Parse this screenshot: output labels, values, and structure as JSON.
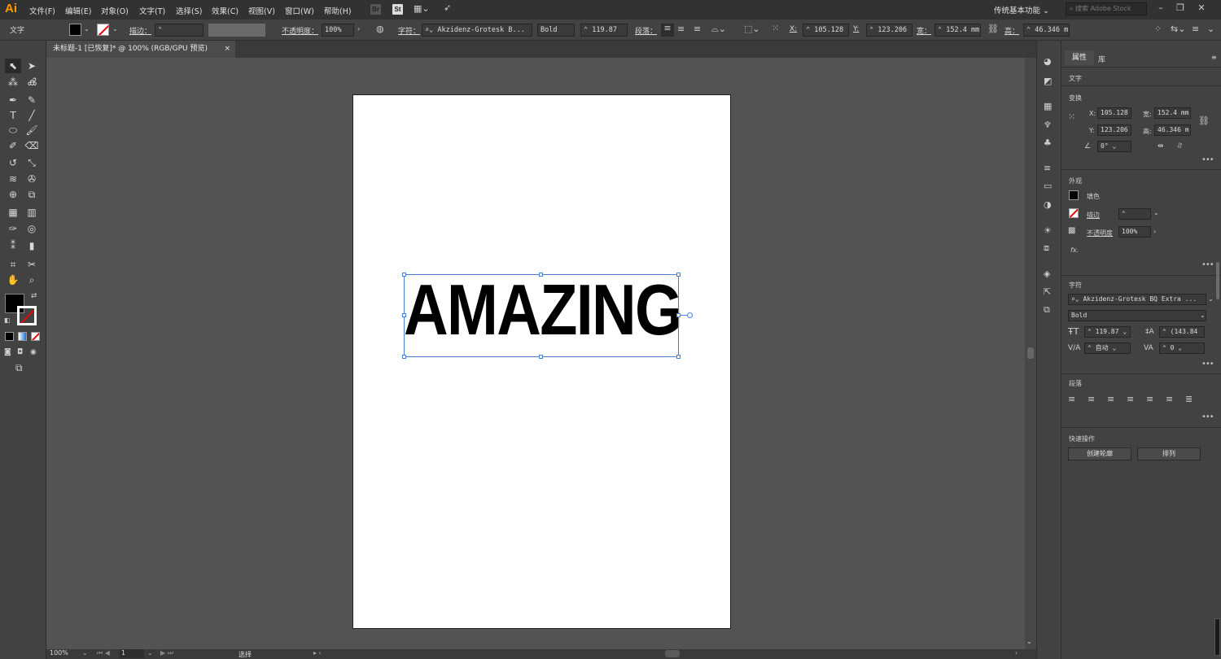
{
  "app": {
    "logo": "Ai"
  },
  "menu": [
    "文件(F)",
    "编辑(E)",
    "对象(O)",
    "文字(T)",
    "选择(S)",
    "效果(C)",
    "视图(V)",
    "窗口(W)",
    "帮助(H)"
  ],
  "menu_icons": {
    "bridge": "Br",
    "stock": "St"
  },
  "workspace": "传统基本功能",
  "search_placeholder": "搜索 Adobe Stock",
  "control": {
    "type_label": "文字",
    "stroke_label": "描边：",
    "opacity_label": "不透明度：",
    "opacity_value": "100%",
    "char_label": "字符：",
    "font_value": "Akzidenz-Grotesk B...",
    "style_value": "Bold",
    "size_value": "119.87",
    "para_label": "段落：",
    "x_label": "X:",
    "x_value": "105.128",
    "y_label": "Y:",
    "y_value": "123.206",
    "w_label": "宽：",
    "w_value": "152.4 mm",
    "h_label": "高：",
    "h_value": "46.346 m"
  },
  "document_tab": {
    "title": "未标题-1 [已恢复]* @ 100% (RGB/GPU 预览)",
    "close": "×"
  },
  "canvas_text": "AMAZING",
  "status": {
    "zoom": "100%",
    "page": "1",
    "mode": "选择"
  },
  "panel": {
    "tab_properties": "属性",
    "tab_library": "库",
    "section_type": "文字",
    "section_transform": "变换",
    "x_label": "X:",
    "x_value": "105.128",
    "y_label": "Y:",
    "y_value": "123.206",
    "w_label": "宽:",
    "w_value": "152.4 mm",
    "h_label": "高:",
    "h_value": "46.346 m",
    "angle_value": "0°",
    "section_appearance": "外观",
    "fill_label": "填色",
    "stroke_label": "描边",
    "opacity_label": "不透明度",
    "opacity_value": "100%",
    "fx": "fx.",
    "section_character": "字符",
    "font_value": "Akzidenz-Grotesk BQ Extra ...",
    "style_value": "Bold",
    "size_value": "119.87",
    "leading_value": "(143.84",
    "kerning_value": "自动",
    "tracking_value": "0",
    "section_paragraph": "段落",
    "section_quick": "快速操作",
    "btn_outline": "创建轮廓",
    "btn_arrange": "排列"
  },
  "colors": {
    "accent": "#ff9a00",
    "selection": "#4a7fd6",
    "ui_dark": "#323232",
    "ui_panel": "#424242",
    "canvas": "#535353"
  }
}
